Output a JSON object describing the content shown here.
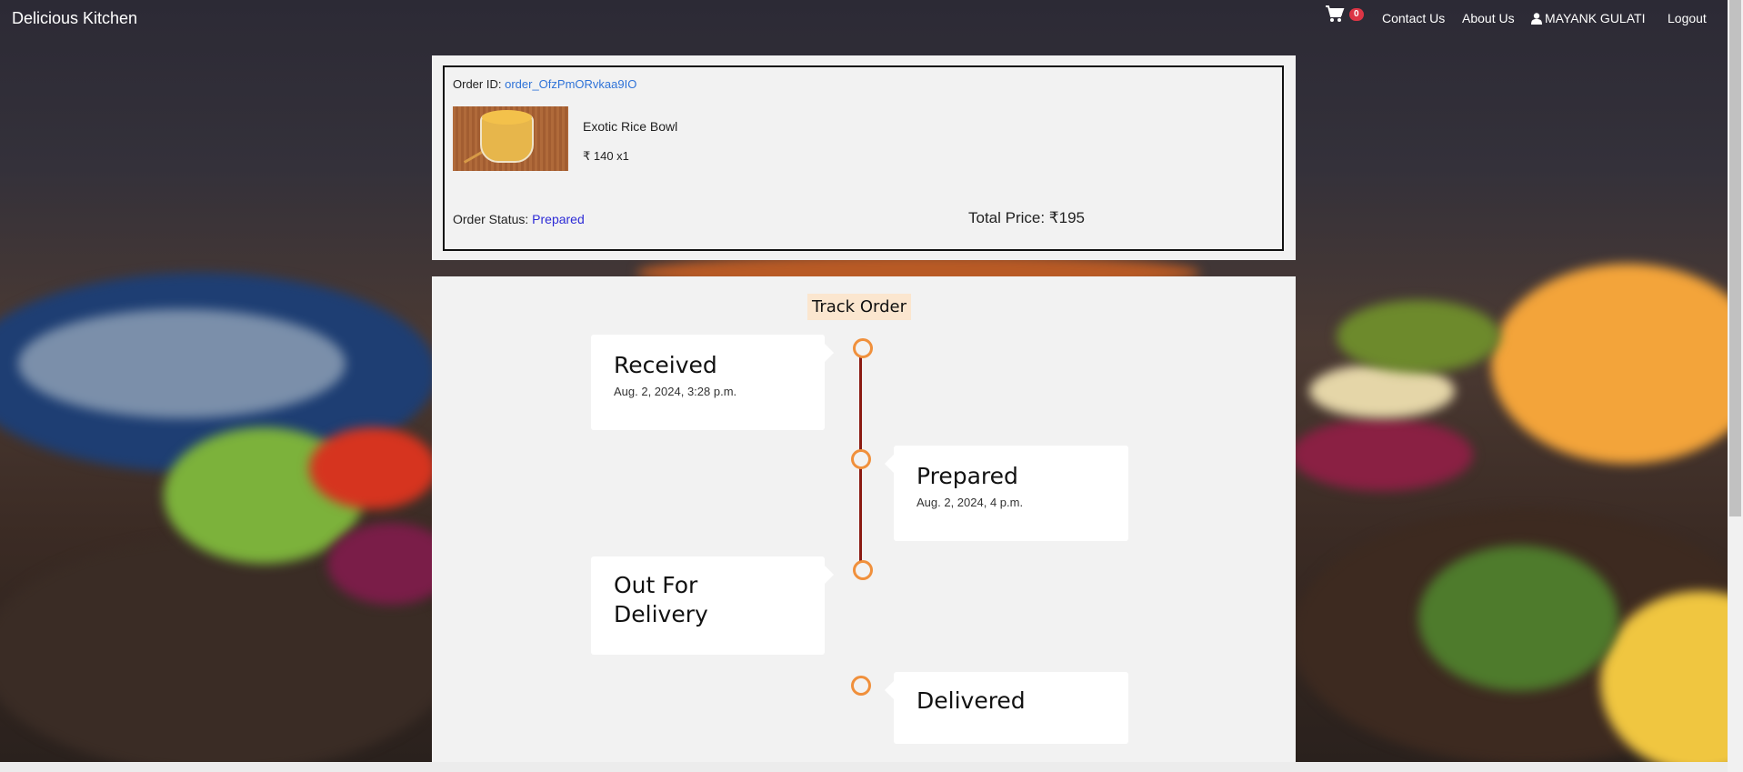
{
  "navbar": {
    "brand": "Delicious Kitchen",
    "cart_count": "0",
    "links": {
      "contact": "Contact Us",
      "about": "About Us",
      "user": "MAYANK GULATI",
      "logout": "Logout"
    }
  },
  "order": {
    "id_label": "Order ID:",
    "id_value": "order_OfzPmORvkaa9IO",
    "item_name": "Exotic Rice Bowl",
    "item_price": "₹ 140 x1",
    "status_label": "Order Status:",
    "status_value": "Prepared",
    "total_price": "Total Price: ₹195"
  },
  "tracking": {
    "title": "Track Order",
    "steps": [
      {
        "label": "Received",
        "time": "Aug. 2, 2024, 3:28 p.m."
      },
      {
        "label": "Prepared",
        "time": "Aug. 2, 2024, 4 p.m."
      },
      {
        "label": "Out For Delivery",
        "time": ""
      },
      {
        "label": "Delivered",
        "time": ""
      }
    ]
  },
  "colors": {
    "accent_link": "#2f73d8",
    "status_value": "#2d2bd6",
    "timeline_line": "#8b1a12",
    "timeline_dot": "#f0903c",
    "track_title_bg": "#fbe6cf",
    "badge": "#dc3545"
  }
}
